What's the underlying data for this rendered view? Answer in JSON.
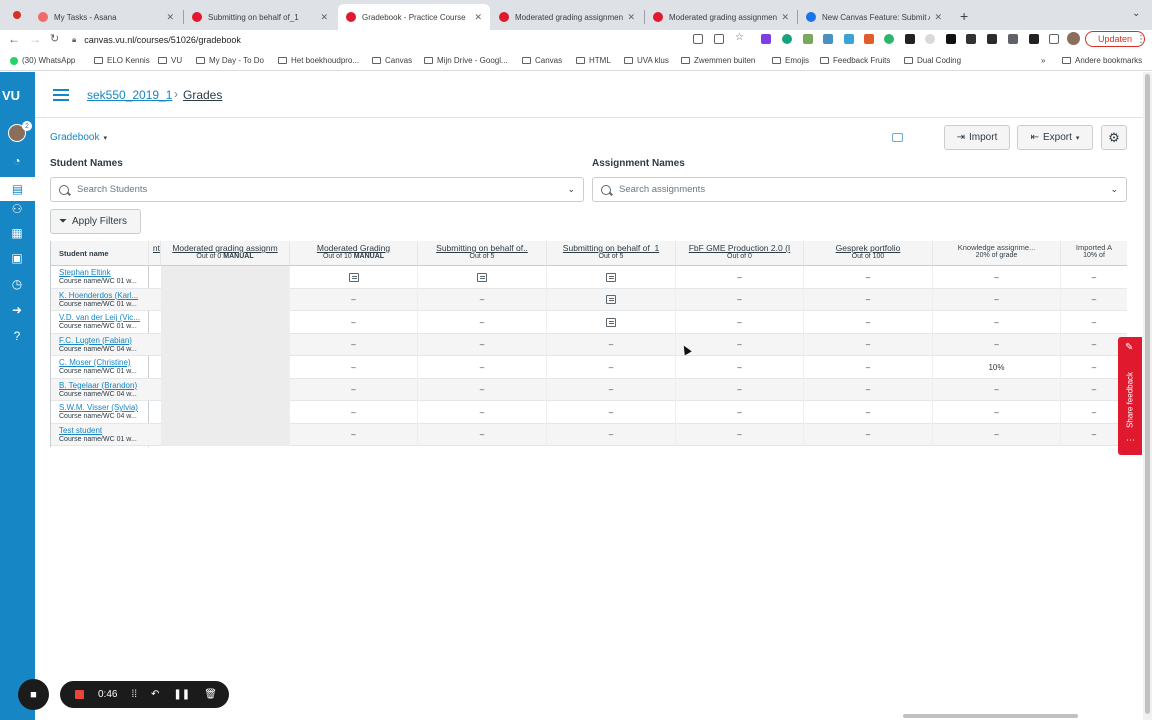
{
  "browser": {
    "tabs": [
      {
        "title": "My Tasks - Asana",
        "color": "#f06a6a",
        "active": false
      },
      {
        "title": "Submitting on behalf of_1",
        "color": "#e0192e",
        "active": false
      },
      {
        "title": "Gradebook - Practice Course",
        "color": "#e0192e",
        "active": true
      },
      {
        "title": "Moderated grading assignmen",
        "color": "#e0192e",
        "active": false
      },
      {
        "title": "Moderated grading assignmen",
        "color": "#e0192e",
        "active": false
      },
      {
        "title": "New Canvas Feature: Submit A",
        "color": "#1a73e8",
        "active": false
      }
    ],
    "url": "canvas.vu.nl/courses/51026/gradebook",
    "update_button": "Updaten",
    "bookmarks": [
      "(30) WhatsApp",
      "ELO Kennis",
      "VU",
      "My Day - To Do",
      "Het boekhoudpro...",
      "Canvas",
      "Mijn Drive - Googl...",
      "Canvas",
      "HTML",
      "UVA klus",
      "Zwemmen buiten",
      "Emojis",
      "Feedback Fruits",
      "Dual Coding"
    ],
    "other_bookmarks": "Andere bookmarks"
  },
  "nav": {
    "logo": "VU",
    "badge": "2"
  },
  "breadcrumb": {
    "course": "sek550_2019_1",
    "separator": "›",
    "page": "Grades"
  },
  "gradebook": {
    "menu_label": "Gradebook",
    "import_label": "Import",
    "export_label": "Export",
    "student_names_label": "Student Names",
    "assignment_names_label": "Assignment Names",
    "search_students_placeholder": "Search Students",
    "search_assignments_placeholder": "Search assignments",
    "apply_filters": "Apply Filters"
  },
  "grid": {
    "student_header": "Student name",
    "cut_header": "nt",
    "columns": [
      {
        "title": "Moderated grading assignm",
        "sub": "Out of 0",
        "manual": "MANUAL"
      },
      {
        "title": "Moderated Grading",
        "sub": "Out of 10",
        "manual": "MANUAL"
      },
      {
        "title": "Submitting on behalf of..",
        "sub": "Out of 5",
        "manual": ""
      },
      {
        "title": "Submitting on behalf of_1",
        "sub": "Out of 5",
        "manual": ""
      },
      {
        "title": "FbF GME Production 2.0 (I",
        "sub": "Out of 0",
        "manual": ""
      },
      {
        "title": "Gesprek portfolio",
        "sub": "Out of 100",
        "manual": ""
      },
      {
        "title": "Knowledge assignme...",
        "sub": "20% of grade",
        "manual": "",
        "plain": true
      },
      {
        "title": "Imported A",
        "sub": "10% of",
        "manual": "",
        "plain": true
      }
    ],
    "students": [
      {
        "name": "Stephan Eltink",
        "section": "Course name/WC 01 w...",
        "cells": [
          "",
          "icon",
          "icon",
          "icon",
          "–",
          "–",
          "–",
          "–"
        ]
      },
      {
        "name": "K. Hoenderdos (Karl...",
        "section": "Course name/WC 01 w...",
        "cells": [
          "",
          "–",
          "–",
          "icon",
          "–",
          "–",
          "–",
          "–"
        ]
      },
      {
        "name": "V.D. van der Leij (Vic...",
        "section": "Course name/WC 01 w...",
        "cells": [
          "",
          "–",
          "–",
          "icon",
          "–",
          "–",
          "–",
          "–"
        ]
      },
      {
        "name": "F.C. Lugten (Fabian)",
        "section": "Course name/WC 04 w...",
        "cells": [
          "",
          "–",
          "–",
          "–",
          "–",
          "–",
          "–",
          "–"
        ]
      },
      {
        "name": "C. Moser (Christine)",
        "section": "Course name/WC 01 w...",
        "cells": [
          "",
          "–",
          "–",
          "–",
          "–",
          "–",
          "10%",
          "–"
        ]
      },
      {
        "name": "B. Tegelaar (Brandon)",
        "section": "Course name/WC 04 w...",
        "cells": [
          "",
          "–",
          "–",
          "–",
          "–",
          "–",
          "–",
          "–"
        ]
      },
      {
        "name": "S.W.M. Visser (Sylvia)",
        "section": "Course name/WC 04 w...",
        "cells": [
          "",
          "–",
          "–",
          "–",
          "–",
          "–",
          "–",
          "–"
        ]
      },
      {
        "name": "Test student",
        "section": "Course name/WC 01 w...",
        "cells": [
          "",
          "–",
          "–",
          "–",
          "–",
          "–",
          "–",
          "–"
        ]
      }
    ]
  },
  "feedback_tab": "Share feedback",
  "recorder": {
    "time": "0:46"
  },
  "colors": {
    "brand": "#1686c5",
    "feedback": "#e0192e"
  }
}
